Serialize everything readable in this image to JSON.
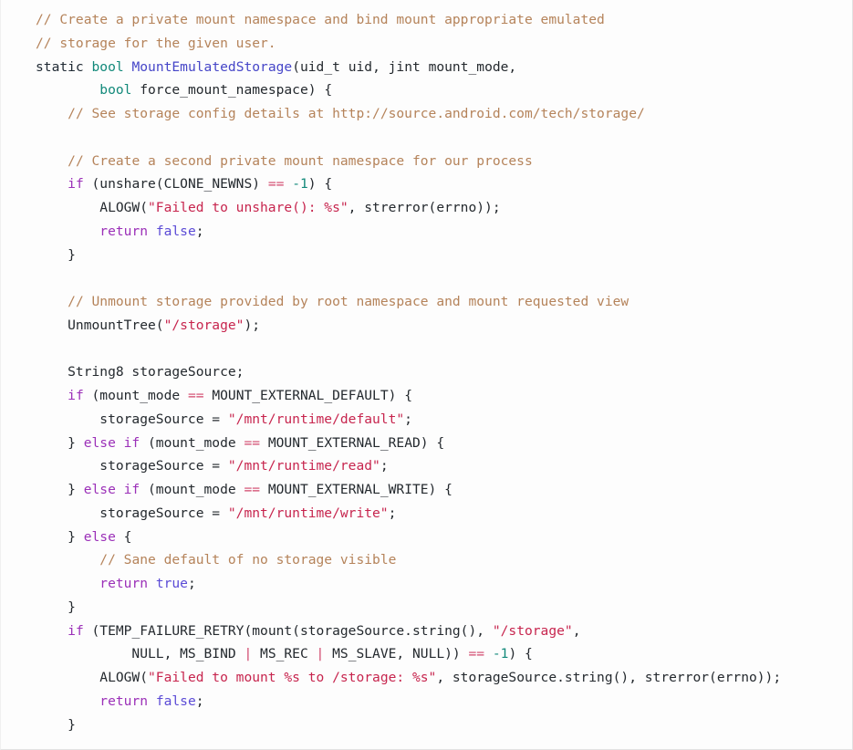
{
  "block": {
    "language": "cpp",
    "title": "MountEmulatedStorage source listing",
    "theme": {
      "background": "#fdfdfd",
      "border": "#e2e2e2",
      "plain": "#24292e",
      "comment": "#b5835a",
      "keyword": "#9b30b8",
      "type": "#12897a",
      "function": "#4646c8",
      "string": "#c7254e",
      "number": "#12897a",
      "operator": "#d1456b",
      "constant": "#5b4bd6"
    }
  },
  "code": {
    "lines": [
      "// Create a private mount namespace and bind mount appropriate emulated",
      "// storage for the given user.",
      "static bool MountEmulatedStorage(uid_t uid, jint mount_mode,",
      "        bool force_mount_namespace) {",
      "    // See storage config details at http://source.android.com/tech/storage/",
      "",
      "    // Create a second private mount namespace for our process",
      "    if (unshare(CLONE_NEWNS) == -1) {",
      "        ALOGW(\"Failed to unshare(): %s\", strerror(errno));",
      "        return false;",
      "    }",
      "",
      "    // Unmount storage provided by root namespace and mount requested view",
      "    UnmountTree(\"/storage\");",
      "",
      "    String8 storageSource;",
      "    if (mount_mode == MOUNT_EXTERNAL_DEFAULT) {",
      "        storageSource = \"/mnt/runtime/default\";",
      "    } else if (mount_mode == MOUNT_EXTERNAL_READ) {",
      "        storageSource = \"/mnt/runtime/read\";",
      "    } else if (mount_mode == MOUNT_EXTERNAL_WRITE) {",
      "        storageSource = \"/mnt/runtime/write\";",
      "    } else {",
      "        // Sane default of no storage visible",
      "        return true;",
      "    }",
      "    if (TEMP_FAILURE_RETRY(mount(storageSource.string(), \"/storage\",",
      "            NULL, MS_BIND | MS_REC | MS_SLAVE, NULL)) == -1) {",
      "        ALOGW(\"Failed to mount %s to /storage: %s\", storageSource.string(), strerror(errno));",
      "        return false;",
      "    }"
    ],
    "tokens": [
      [
        {
          "t": "comment",
          "v": "// Create a private mount namespace and bind mount appropriate emulated"
        }
      ],
      [
        {
          "t": "comment",
          "v": "// storage for the given user."
        }
      ],
      [
        {
          "t": "kw-dark",
          "v": "static"
        },
        {
          "t": "plain",
          "v": " "
        },
        {
          "t": "type",
          "v": "bool"
        },
        {
          "t": "plain",
          "v": " "
        },
        {
          "t": "func",
          "v": "MountEmulatedStorage"
        },
        {
          "t": "plain",
          "v": "(uid_t uid, jint mount_mode,"
        }
      ],
      [
        {
          "t": "plain",
          "v": "        "
        },
        {
          "t": "type",
          "v": "bool"
        },
        {
          "t": "plain",
          "v": " force_mount_namespace) {"
        }
      ],
      [
        {
          "t": "plain",
          "v": "    "
        },
        {
          "t": "comment",
          "v": "// See storage config details at http://source.android.com/tech/storage/"
        }
      ],
      [
        {
          "t": "plain",
          "v": ""
        }
      ],
      [
        {
          "t": "plain",
          "v": "    "
        },
        {
          "t": "comment",
          "v": "// Create a second private mount namespace for our process"
        }
      ],
      [
        {
          "t": "plain",
          "v": "    "
        },
        {
          "t": "keyword",
          "v": "if"
        },
        {
          "t": "plain",
          "v": " (unshare(CLONE_NEWNS) "
        },
        {
          "t": "op",
          "v": "=="
        },
        {
          "t": "plain",
          "v": " "
        },
        {
          "t": "number",
          "v": "-1"
        },
        {
          "t": "plain",
          "v": ") {"
        }
      ],
      [
        {
          "t": "plain",
          "v": "        ALOGW("
        },
        {
          "t": "string",
          "v": "\"Failed to unshare(): %s\""
        },
        {
          "t": "plain",
          "v": ", strerror(errno));"
        }
      ],
      [
        {
          "t": "plain",
          "v": "        "
        },
        {
          "t": "keyword",
          "v": "return"
        },
        {
          "t": "plain",
          "v": " "
        },
        {
          "t": "const",
          "v": "false"
        },
        {
          "t": "plain",
          "v": ";"
        }
      ],
      [
        {
          "t": "plain",
          "v": "    }"
        }
      ],
      [
        {
          "t": "plain",
          "v": ""
        }
      ],
      [
        {
          "t": "plain",
          "v": "    "
        },
        {
          "t": "comment",
          "v": "// Unmount storage provided by root namespace and mount requested view"
        }
      ],
      [
        {
          "t": "plain",
          "v": "    UnmountTree("
        },
        {
          "t": "string",
          "v": "\"/storage\""
        },
        {
          "t": "plain",
          "v": ");"
        }
      ],
      [
        {
          "t": "plain",
          "v": ""
        }
      ],
      [
        {
          "t": "plain",
          "v": "    String8 storageSource;"
        }
      ],
      [
        {
          "t": "plain",
          "v": "    "
        },
        {
          "t": "keyword",
          "v": "if"
        },
        {
          "t": "plain",
          "v": " (mount_mode "
        },
        {
          "t": "op",
          "v": "=="
        },
        {
          "t": "plain",
          "v": " MOUNT_EXTERNAL_DEFAULT) {"
        }
      ],
      [
        {
          "t": "plain",
          "v": "        storageSource = "
        },
        {
          "t": "string",
          "v": "\"/mnt/runtime/default\""
        },
        {
          "t": "plain",
          "v": ";"
        }
      ],
      [
        {
          "t": "plain",
          "v": "    } "
        },
        {
          "t": "keyword",
          "v": "else if"
        },
        {
          "t": "plain",
          "v": " (mount_mode "
        },
        {
          "t": "op",
          "v": "=="
        },
        {
          "t": "plain",
          "v": " MOUNT_EXTERNAL_READ) {"
        }
      ],
      [
        {
          "t": "plain",
          "v": "        storageSource = "
        },
        {
          "t": "string",
          "v": "\"/mnt/runtime/read\""
        },
        {
          "t": "plain",
          "v": ";"
        }
      ],
      [
        {
          "t": "plain",
          "v": "    } "
        },
        {
          "t": "keyword",
          "v": "else if"
        },
        {
          "t": "plain",
          "v": " (mount_mode "
        },
        {
          "t": "op",
          "v": "=="
        },
        {
          "t": "plain",
          "v": " MOUNT_EXTERNAL_WRITE) {"
        }
      ],
      [
        {
          "t": "plain",
          "v": "        storageSource = "
        },
        {
          "t": "string",
          "v": "\"/mnt/runtime/write\""
        },
        {
          "t": "plain",
          "v": ";"
        }
      ],
      [
        {
          "t": "plain",
          "v": "    } "
        },
        {
          "t": "keyword",
          "v": "else"
        },
        {
          "t": "plain",
          "v": " {"
        }
      ],
      [
        {
          "t": "plain",
          "v": "        "
        },
        {
          "t": "comment",
          "v": "// Sane default of no storage visible"
        }
      ],
      [
        {
          "t": "plain",
          "v": "        "
        },
        {
          "t": "keyword",
          "v": "return"
        },
        {
          "t": "plain",
          "v": " "
        },
        {
          "t": "const",
          "v": "true"
        },
        {
          "t": "plain",
          "v": ";"
        }
      ],
      [
        {
          "t": "plain",
          "v": "    }"
        }
      ],
      [
        {
          "t": "plain",
          "v": "    "
        },
        {
          "t": "keyword",
          "v": "if"
        },
        {
          "t": "plain",
          "v": " (TEMP_FAILURE_RETRY(mount(storageSource.string(), "
        },
        {
          "t": "string",
          "v": "\"/storage\""
        },
        {
          "t": "plain",
          "v": ","
        }
      ],
      [
        {
          "t": "plain",
          "v": "            NULL, MS_BIND "
        },
        {
          "t": "op",
          "v": "|"
        },
        {
          "t": "plain",
          "v": " MS_REC "
        },
        {
          "t": "op",
          "v": "|"
        },
        {
          "t": "plain",
          "v": " MS_SLAVE, NULL)) "
        },
        {
          "t": "op",
          "v": "=="
        },
        {
          "t": "plain",
          "v": " "
        },
        {
          "t": "number",
          "v": "-1"
        },
        {
          "t": "plain",
          "v": ") {"
        }
      ],
      [
        {
          "t": "plain",
          "v": "        ALOGW("
        },
        {
          "t": "string",
          "v": "\"Failed to mount %s to /storage: %s\""
        },
        {
          "t": "plain",
          "v": ", storageSource.string(), strerror(errno));"
        }
      ],
      [
        {
          "t": "plain",
          "v": "        "
        },
        {
          "t": "keyword",
          "v": "return"
        },
        {
          "t": "plain",
          "v": " "
        },
        {
          "t": "const",
          "v": "false"
        },
        {
          "t": "plain",
          "v": ";"
        }
      ],
      [
        {
          "t": "plain",
          "v": "    }"
        }
      ]
    ]
  }
}
